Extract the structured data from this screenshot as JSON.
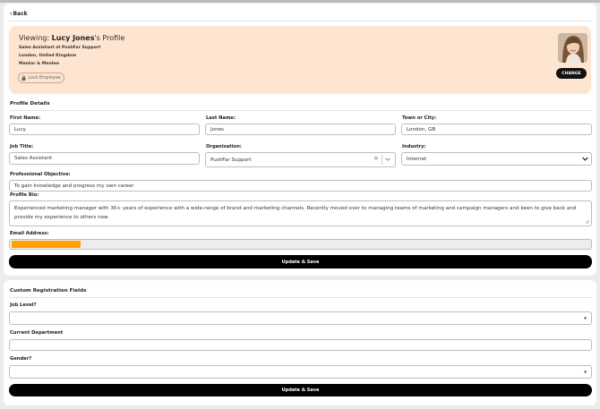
{
  "nav": {
    "back_label": "Back"
  },
  "profile_banner": {
    "viewing_prefix": "Viewing: ",
    "user_name": "Lucy Jones",
    "name_suffix": "'s Profile",
    "role_line": "Sales Assistant at PushFar Support",
    "location": "London, United Kingdom",
    "status": "Mentor & Mentee",
    "lock_button_label": "Lock Employee",
    "change_button_label": "CHANGE"
  },
  "profile_details": {
    "section_title": "Profile Details",
    "first_name": {
      "label": "First Name:",
      "value": "Lucy"
    },
    "last_name": {
      "label": "Last Name:",
      "value": "Jones"
    },
    "town": {
      "label": "Town or City:",
      "value": "London, GB"
    },
    "job_title": {
      "label": "Job Title:",
      "value": "Sales Assistant"
    },
    "organisation": {
      "label": "Organisation:",
      "value": "PushFar Support"
    },
    "industry": {
      "label": "Industry:",
      "value": "Internet"
    },
    "objective": {
      "label": "Professional Objective:",
      "value": "To gain knowledge and progress my own career"
    },
    "bio": {
      "label": "Profile Bio:",
      "value": "Experienced marketing manager with 30+ years of experience with a wide-range of brand and marketing channels. Recently moved over to managing teams of marketing and campaign managers and keen to give back and provide my experience to others now."
    },
    "email": {
      "label": "Email Address:"
    },
    "save_label": "Update & Save"
  },
  "custom_fields": {
    "section_title": "Custom Registration Fields",
    "job_level": {
      "label": "Job Level?",
      "value": ""
    },
    "department": {
      "label": "Current Department",
      "value": ""
    },
    "gender": {
      "label": "Gender?",
      "value": ""
    },
    "save_label": "Update & Save"
  },
  "colors": {
    "banner_bg": "#fde5d2",
    "button_bg": "#000000",
    "redaction": "#ffa200",
    "page_bg": "#ececec"
  },
  "icons": {
    "back": "chevron-left-icon",
    "lock": "lock-icon",
    "clear": "close-icon",
    "dropdown": "chevron-down-icon",
    "select_caret": "caret-down-icon",
    "resize": "resize-handle-icon"
  }
}
